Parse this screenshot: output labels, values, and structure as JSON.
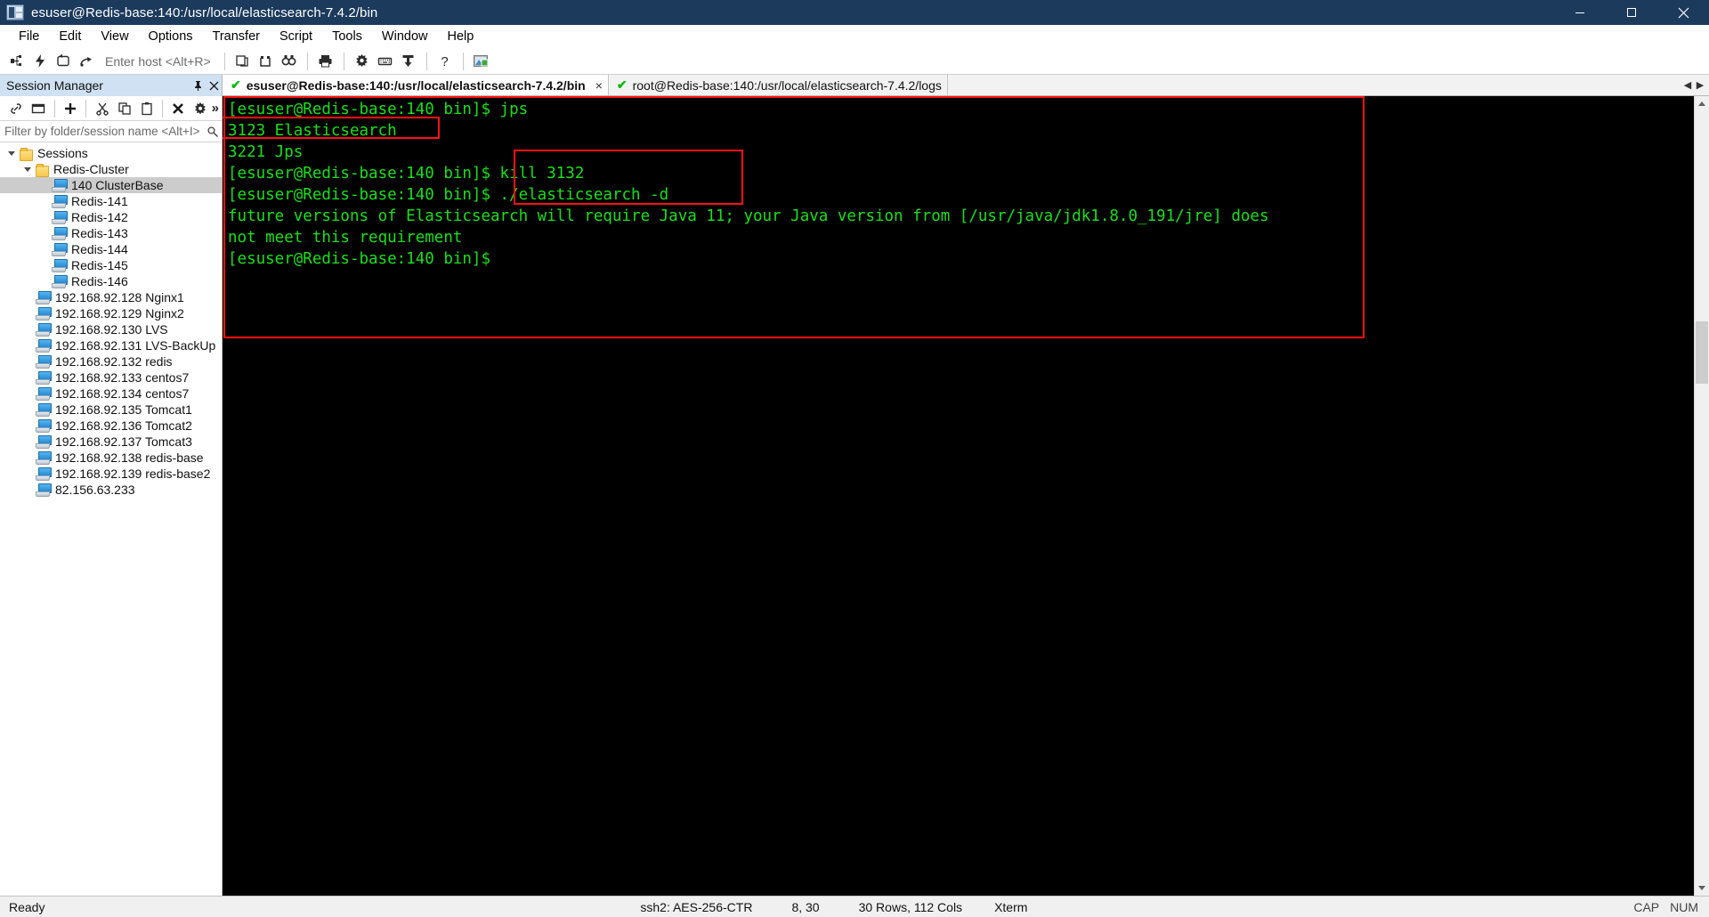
{
  "window": {
    "title": "esuser@Redis-base:140:/usr/local/elasticsearch-7.4.2/bin",
    "minimize_label": "Minimize",
    "maximize_label": "Maximize",
    "close_label": "Close"
  },
  "menubar": {
    "items": [
      {
        "label": "File"
      },
      {
        "label": "Edit"
      },
      {
        "label": "View"
      },
      {
        "label": "Options"
      },
      {
        "label": "Transfer"
      },
      {
        "label": "Script"
      },
      {
        "label": "Tools"
      },
      {
        "label": "Window"
      },
      {
        "label": "Help"
      }
    ]
  },
  "toolbar": {
    "host_placeholder": "Enter host <Alt+R>",
    "icons": [
      "connect-icon",
      "quick-connect-icon",
      "reconnect-icon",
      "connect-sftp-icon",
      "clone-session-icon",
      "new-tab-icon",
      "find-icon",
      "print-icon",
      "settings-icon",
      "keymap-icon",
      "transfer-icon",
      "help-icon",
      "image-icon"
    ]
  },
  "session_manager": {
    "title": "Session Manager",
    "pin_label": "Pin",
    "close_label": "Close",
    "toolbar_icons": [
      "link-icon",
      "folder-window-icon",
      "add-icon",
      "cut-icon",
      "copy-icon",
      "paste-icon",
      "delete-icon",
      "properties-icon"
    ],
    "overflow_label": "»",
    "filter_placeholder": "Filter by folder/session name <Alt+I>",
    "filter_icon": "filter-icon",
    "tree": [
      {
        "label": "Sessions",
        "type": "folder",
        "indent": 0,
        "expanded": true,
        "selected": false
      },
      {
        "label": "Redis-Cluster",
        "type": "folder",
        "indent": 1,
        "expanded": true,
        "selected": false
      },
      {
        "label": "140 ClusterBase",
        "type": "session",
        "indent": 2,
        "selected": true
      },
      {
        "label": "Redis-141",
        "type": "session",
        "indent": 2,
        "selected": false
      },
      {
        "label": "Redis-142",
        "type": "session",
        "indent": 2,
        "selected": false
      },
      {
        "label": "Redis-143",
        "type": "session",
        "indent": 2,
        "selected": false
      },
      {
        "label": "Redis-144",
        "type": "session",
        "indent": 2,
        "selected": false
      },
      {
        "label": "Redis-145",
        "type": "session",
        "indent": 2,
        "selected": false
      },
      {
        "label": "Redis-146",
        "type": "session",
        "indent": 2,
        "selected": false
      },
      {
        "label": "192.168.92.128  Nginx1",
        "type": "session",
        "indent": 1,
        "selected": false
      },
      {
        "label": "192.168.92.129  Nginx2",
        "type": "session",
        "indent": 1,
        "selected": false
      },
      {
        "label": "192.168.92.130  LVS",
        "type": "session",
        "indent": 1,
        "selected": false
      },
      {
        "label": "192.168.92.131  LVS-BackUp",
        "type": "session",
        "indent": 1,
        "selected": false
      },
      {
        "label": "192.168.92.132  redis",
        "type": "session",
        "indent": 1,
        "selected": false
      },
      {
        "label": "192.168.92.133  centos7",
        "type": "session",
        "indent": 1,
        "selected": false
      },
      {
        "label": "192.168.92.134  centos7",
        "type": "session",
        "indent": 1,
        "selected": false
      },
      {
        "label": "192.168.92.135  Tomcat1",
        "type": "session",
        "indent": 1,
        "selected": false
      },
      {
        "label": "192.168.92.136  Tomcat2",
        "type": "session",
        "indent": 1,
        "selected": false
      },
      {
        "label": "192.168.92.137  Tomcat3",
        "type": "session",
        "indent": 1,
        "selected": false
      },
      {
        "label": "192.168.92.138  redis-base",
        "type": "session",
        "indent": 1,
        "selected": false
      },
      {
        "label": "192.168.92.139  redis-base2",
        "type": "session",
        "indent": 1,
        "selected": false
      },
      {
        "label": "82.156.63.233",
        "type": "session",
        "indent": 1,
        "selected": false
      }
    ]
  },
  "tabs": {
    "items": [
      {
        "label": "esuser@Redis-base:140:/usr/local/elasticsearch-7.4.2/bin",
        "active": true,
        "status_icon": "connected-check-icon",
        "close_label": "×"
      },
      {
        "label": "root@Redis-base:140:/usr/local/elasticsearch-7.4.2/logs",
        "active": false,
        "status_icon": "connected-check-icon",
        "close_label": ""
      }
    ],
    "nav_prev": "◀",
    "nav_next": "▶"
  },
  "terminal": {
    "foreground_color": "#18e018",
    "background_color": "#000000",
    "lines": [
      "[esuser@Redis-base:140 bin]$ jps",
      "3123 Elasticsearch",
      "3221 Jps",
      "[esuser@Redis-base:140 bin]$ kill 3132",
      "[esuser@Redis-base:140 bin]$ ./elasticsearch -d",
      "future versions of Elasticsearch will require Java 11; your Java version from [/usr/java/jdk1.8.0_191/jre] does",
      "not meet this requirement",
      "[esuser@Redis-base:140 bin]$"
    ]
  },
  "annotations": {
    "color": "#ff1010",
    "boxes": [
      {
        "name": "outer-terminal-highlight"
      },
      {
        "name": "pid-elasticsearch-highlight"
      },
      {
        "name": "commands-highlight"
      }
    ]
  },
  "statusbar": {
    "ready": "Ready",
    "cipher": "ssh2: AES-256-CTR",
    "cursor": "8, 30",
    "dimensions": "30 Rows, 112 Cols",
    "emulation": "Xterm",
    "cap": "CAP",
    "num": "NUM"
  }
}
